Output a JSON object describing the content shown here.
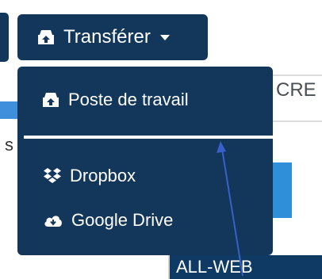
{
  "toolbar": {
    "transfer_label": "Transférer",
    "upload_icon": "upload-tray-icon",
    "caret_icon": "caret-down-icon"
  },
  "dropdown": {
    "items": [
      {
        "label": "Poste de travail",
        "icon": "upload-tray-icon"
      },
      {
        "label": "Dropbox",
        "icon": "dropbox-icon"
      },
      {
        "label": "Google Drive",
        "icon": "cloud-download-icon"
      }
    ]
  },
  "background": {
    "fragment_text": "CRE",
    "fragment_s": "s",
    "folder_label": "ALL-WEB"
  },
  "colors": {
    "menu_bg": "#13375b",
    "text": "#ffffff",
    "accent_blue": "#2f8fd8",
    "annotation_arrow": "#3a5fc8"
  }
}
